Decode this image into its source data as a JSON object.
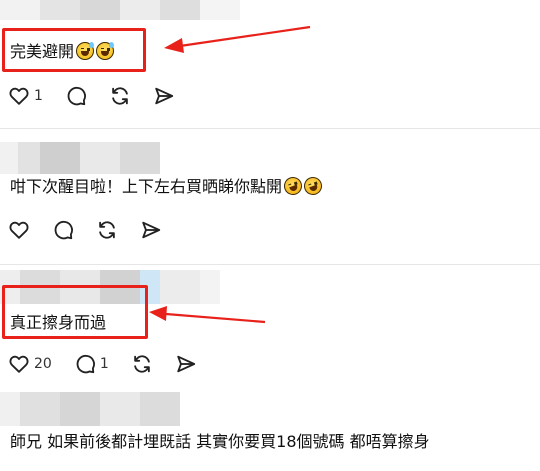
{
  "comments": [
    {
      "text": "完美避開",
      "emoji": [
        "grinning-sweat-emoji",
        "grinning-sweat-emoji"
      ],
      "like_count": "1",
      "reply_count": ""
    },
    {
      "text": "咁下次醒目啦！上下左右買晒睇你點開",
      "emoji": [
        "rolling-laughing-emoji",
        "rolling-laughing-emoji"
      ],
      "like_count": "",
      "reply_count": ""
    },
    {
      "text": "真正擦身而過",
      "emoji": [],
      "like_count": "20",
      "reply_count": "1"
    },
    {
      "text": "師兄 如果前後都計埋既話 其實你要買18個號碼 都唔算擦身",
      "emoji": [],
      "like_count": "",
      "reply_count": ""
    }
  ],
  "icons": {
    "like": "heart-icon",
    "reply": "comment-bubble-icon",
    "repost": "repost-icon",
    "share": "send-icon"
  },
  "colors": {
    "highlight": "#e8221a",
    "icon": "#222222",
    "divider": "#e6e6e6"
  }
}
